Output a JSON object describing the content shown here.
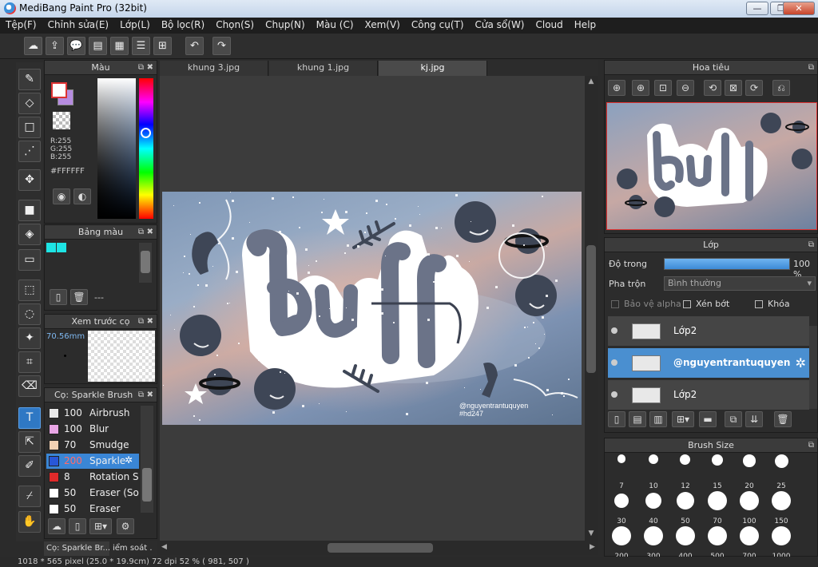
{
  "window": {
    "title": "MediBang Paint Pro (32bit)"
  },
  "menu": [
    "Tệp(F)",
    "Chỉnh sửa(E)",
    "Lớp(L)",
    "Bộ lọc(R)",
    "Chọn(S)",
    "Chụp(N)",
    "Màu (C)",
    "Xem(V)",
    "Công cụ(T)",
    "Cửa sổ(W)",
    "Cloud",
    "Help"
  ],
  "color_panel": {
    "title": "Màu",
    "r": "R:255",
    "g": "G:255",
    "b": "B:255",
    "hex": "#FFFFFF"
  },
  "palette_panel": {
    "title": "Bảng màu",
    "value": "---"
  },
  "brush_preview": {
    "title": "Xem trước cọ",
    "size": "70.56mm"
  },
  "brush_panel": {
    "title": "Cọ: Sparkle Brush",
    "items": [
      {
        "size": "100",
        "name": "Airbrush",
        "color": "#e8e8e8"
      },
      {
        "size": "100",
        "name": "Blur",
        "color": "#e9a6e6"
      },
      {
        "size": "70",
        "name": "Smudge",
        "color": "#f3d2b4"
      },
      {
        "size": "200",
        "name": "Sparkle",
        "color": "#2857d8"
      },
      {
        "size": "8",
        "name": "Rotation Sy",
        "color": "#e02a2a"
      },
      {
        "size": "50",
        "name": "Eraser (Soft",
        "color": "#ffffff"
      },
      {
        "size": "50",
        "name": "Eraser",
        "color": "#ffffff"
      }
    ]
  },
  "bottom_tabs": {
    "brush": "Cọ: Sparkle Br...",
    "control": "iểm soát ."
  },
  "tabs": [
    "khung 3.jpg",
    "khung 1.jpg",
    "kj.jpg"
  ],
  "artwork": {
    "word": "buff",
    "credit_line1": "@nguyentrantuquyen",
    "credit_line2": "#hd247"
  },
  "navigator": {
    "title": "Hoa tiêu"
  },
  "layers": {
    "title": "Lớp",
    "opacity_label": "Độ trong",
    "opacity_value": "100 %",
    "opacity_fraction": 1.0,
    "blend_label": "Pha trộn",
    "blend_value": "Bình thường",
    "protect_alpha": "Bảo vệ alpha",
    "clipping": "Xén bớt",
    "lock": "Khóa",
    "items": [
      {
        "name": "Lớp2",
        "selected": false
      },
      {
        "name": "@nguyentrantuquyen",
        "selected": true
      },
      {
        "name": "Lớp2",
        "selected": false
      }
    ]
  },
  "brush_size": {
    "title": "Brush Size",
    "sizes": [
      "7",
      "10",
      "12",
      "15",
      "20",
      "25",
      "30",
      "40",
      "50",
      "70",
      "100",
      "150",
      "200",
      "300",
      "400",
      "500",
      "700",
      "1000"
    ]
  },
  "status": {
    "text": "1018 * 565 pixel   (25.0 * 19.9cm)   72 dpi   52 %   ( 981, 507 )"
  }
}
